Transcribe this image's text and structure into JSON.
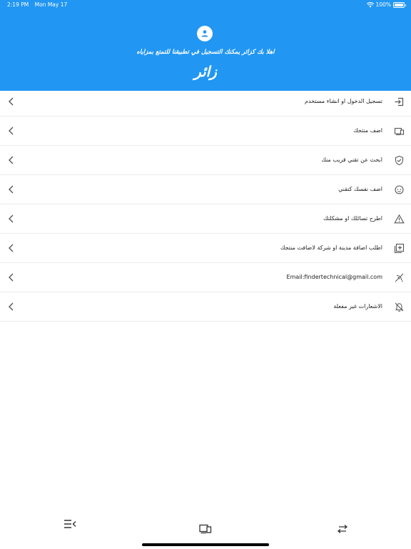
{
  "status_bar": {
    "time": "2:19 PM",
    "date": "Mon May 17",
    "battery": "100%",
    "icons": [
      "wifi-icon",
      "battery-icon"
    ]
  },
  "header": {
    "welcome_text": "اهلا بك كزائر يمكنك التسجيل في تطبيقنا للتمتع بمزاياه",
    "user_title": "زائر",
    "color": "#2196f3"
  },
  "menu": {
    "items": [
      {
        "label": "تسجيل الدخول او انشاء مستخدم",
        "icon": "login-icon"
      },
      {
        "label": "اضف منتجك",
        "icon": "devices-icon"
      },
      {
        "label": "ابحث عن تقني قريب منك",
        "icon": "shield-icon"
      },
      {
        "label": "اضف نفسك كتقني",
        "icon": "face-icon"
      },
      {
        "label": "اطرح تسائلك او مشكلتك",
        "icon": "warning-icon"
      },
      {
        "label": "اطلب اضافة مدينة  او شركة لاضافت منتجك",
        "icon": "add-box-icon"
      },
      {
        "label": "Email:findertechnical@gmail.com",
        "icon": "email-signal-icon"
      },
      {
        "label": "الاشعارات غير مفعلة",
        "icon": "notifications-off-icon"
      }
    ],
    "chevron_icon": "chevron-left-icon"
  },
  "bottom_nav": {
    "items": [
      "menu-icon",
      "devices-icon",
      "swap-icon"
    ]
  }
}
